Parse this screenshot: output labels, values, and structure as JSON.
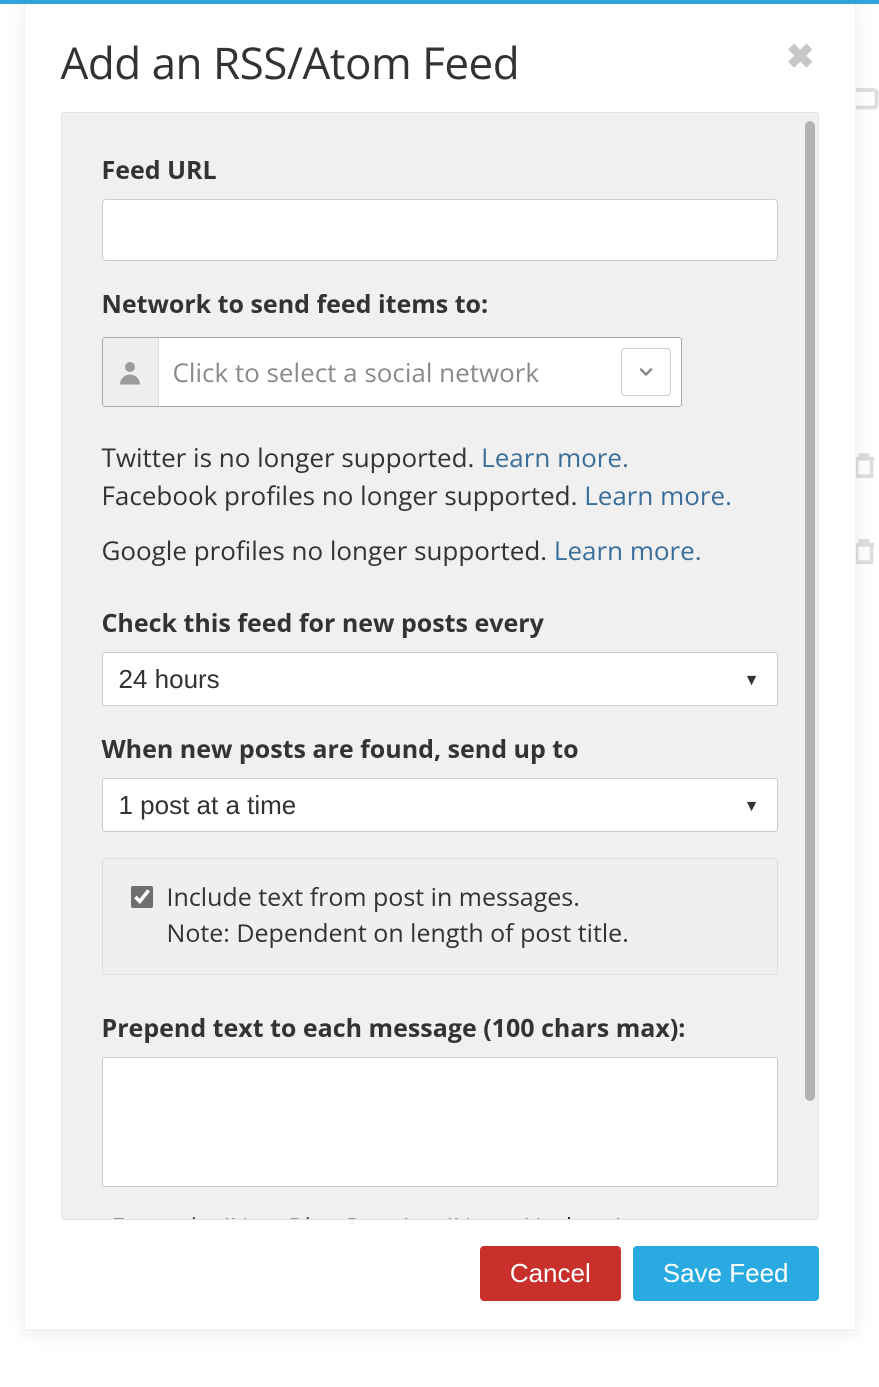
{
  "header": {
    "title": "Add an RSS/Atom Feed"
  },
  "form": {
    "feed_url_label": "Feed URL",
    "feed_url_value": "",
    "network_label": "Network to send feed items to:",
    "network_placeholder": "Click to select a social network",
    "info_twitter_text": "Twitter is no longer supported. ",
    "info_twitter_link": "Learn more.",
    "info_facebook_text": "Facebook profiles no longer supported. ",
    "info_facebook_link": "Learn more.",
    "info_google_text": "Google profiles no longer supported. ",
    "info_google_link": "Learn more.",
    "check_interval_label": "Check this feed for new posts every",
    "check_interval_value": "24 hours",
    "send_up_to_label": "When new posts are found, send up to",
    "send_up_to_value": "1 post at a time",
    "include_text_checked": true,
    "include_text_label": "Include text from post in messages.",
    "include_text_note": "Note: Dependent on length of post title.",
    "prepend_label": "Prepend text to each message (100 chars max):",
    "prepend_value": "",
    "prepend_example": "Example: 'New Blog Post:' or 'News Update:'"
  },
  "footer": {
    "cancel_label": "Cancel",
    "save_label": "Save Feed"
  }
}
